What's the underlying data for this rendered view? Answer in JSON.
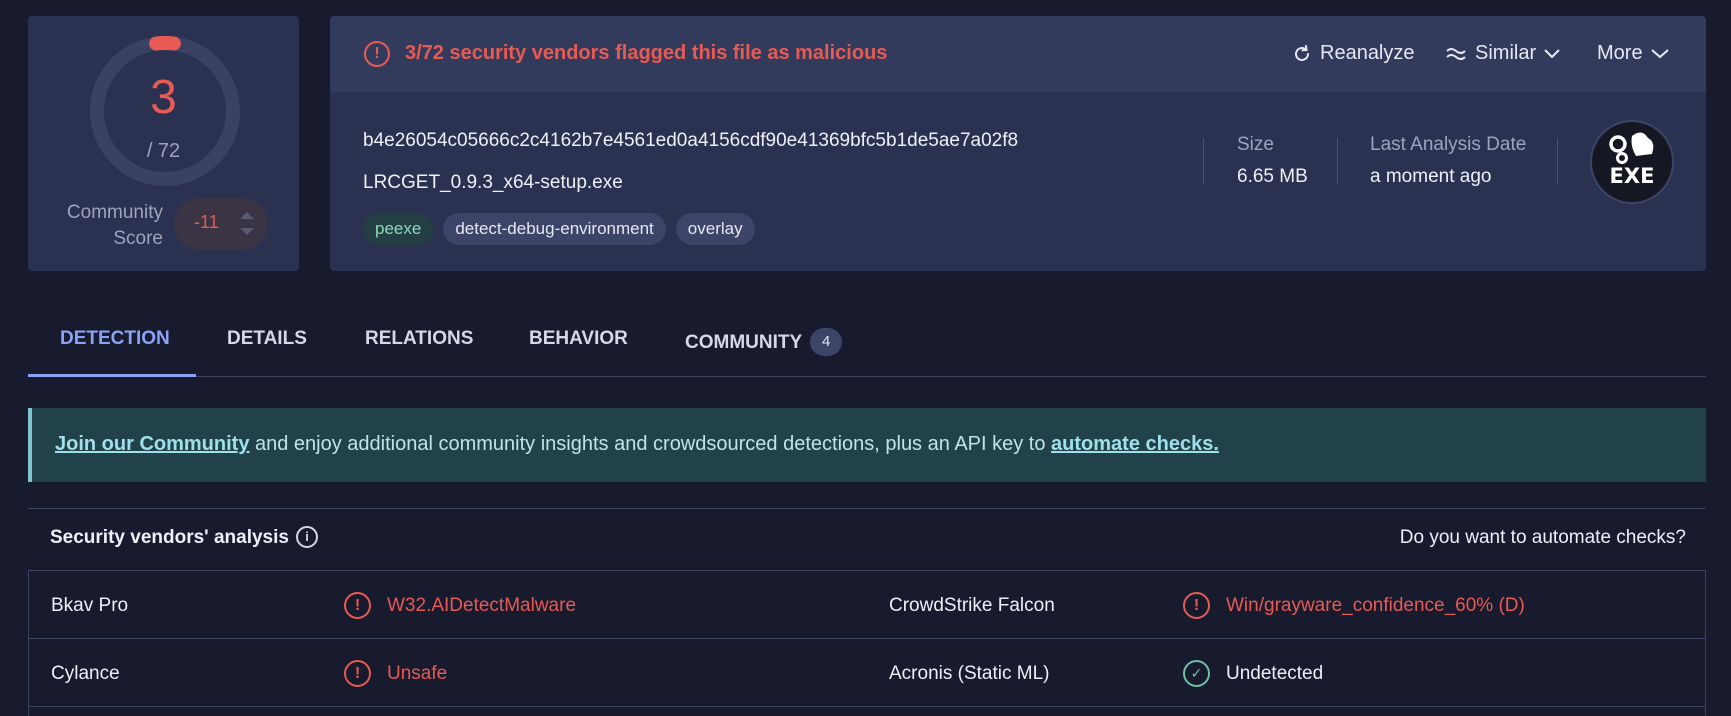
{
  "score": {
    "detected": "3",
    "total": "/ 72",
    "detected_fraction": 0.0417,
    "community_label_line1": "Community",
    "community_label_line2": "Score",
    "community_value": "-11"
  },
  "alert": {
    "text": "3/72 security vendors flagged this file as malicious"
  },
  "actions": {
    "reanalyze": "Reanalyze",
    "similar": "Similar",
    "more": "More"
  },
  "file": {
    "hash": "b4e26054c05666c2c4162b7e4561ed0a4156cdf90e41369bfc5b1de5ae7a02f8",
    "name": "LRCGET_0.9.3_x64-setup.exe",
    "tags": [
      "peexe",
      "detect-debug-environment",
      "overlay"
    ],
    "size_label": "Size",
    "size_value": "6.65 MB",
    "date_label": "Last Analysis Date",
    "date_value": "a moment ago",
    "type_badge": "EXE"
  },
  "tabs": [
    {
      "label": "DETECTION"
    },
    {
      "label": "DETAILS"
    },
    {
      "label": "RELATIONS"
    },
    {
      "label": "BEHAVIOR"
    },
    {
      "label": "COMMUNITY",
      "badge": "4"
    }
  ],
  "banner": {
    "link1": "Join our Community",
    "middle": " and enjoy additional community insights and crowdsourced detections, plus an API key to ",
    "link2": "automate checks."
  },
  "vendors": {
    "title": "Security vendors' analysis",
    "automate_prompt": "Do you want to automate checks?",
    "rows": [
      {
        "left_name": "Bkav Pro",
        "left_result": "W32.AIDetectMalware",
        "left_status": "malicious",
        "right_name": "CrowdStrike Falcon",
        "right_result": "Win/grayware_confidence_60% (D)",
        "right_status": "malicious"
      },
      {
        "left_name": "Cylance",
        "left_result": "Unsafe",
        "left_status": "malicious",
        "right_name": "Acronis (Static ML)",
        "right_result": "Undetected",
        "right_status": "undetected"
      }
    ]
  },
  "colors": {
    "malicious": "#e85a54",
    "accent": "#8aa2f5",
    "undetected": "#6fc0a8",
    "background": "#181a2d",
    "card": "#2b3150"
  }
}
